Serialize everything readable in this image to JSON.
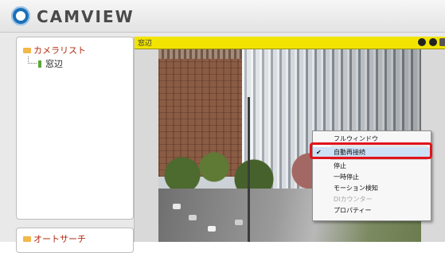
{
  "app": {
    "title": "CAMVIEW"
  },
  "sidebar": {
    "camera_list_label": "カメラリスト",
    "cameras": [
      {
        "label": "窓辺"
      }
    ],
    "autosearch_label": "オートサーチ"
  },
  "view": {
    "title": "窓辺"
  },
  "context_menu": {
    "items": [
      {
        "label": "フルウィンドウ",
        "checked": false,
        "disabled": false
      },
      {
        "label": "自動再接続",
        "checked": true,
        "disabled": false,
        "highlighted": true
      },
      {
        "label": "停止",
        "checked": false,
        "disabled": false
      },
      {
        "label": "一時停止",
        "checked": false,
        "disabled": false
      },
      {
        "label": "モーション検知",
        "checked": false,
        "disabled": false
      },
      {
        "label": "DIカウンター",
        "checked": false,
        "disabled": true
      },
      {
        "label": "プロパティー",
        "checked": false,
        "disabled": false
      }
    ]
  },
  "colors": {
    "highlight": "#e0141b",
    "title_bar": "#f1e400",
    "brand": "#1b6fb8"
  }
}
